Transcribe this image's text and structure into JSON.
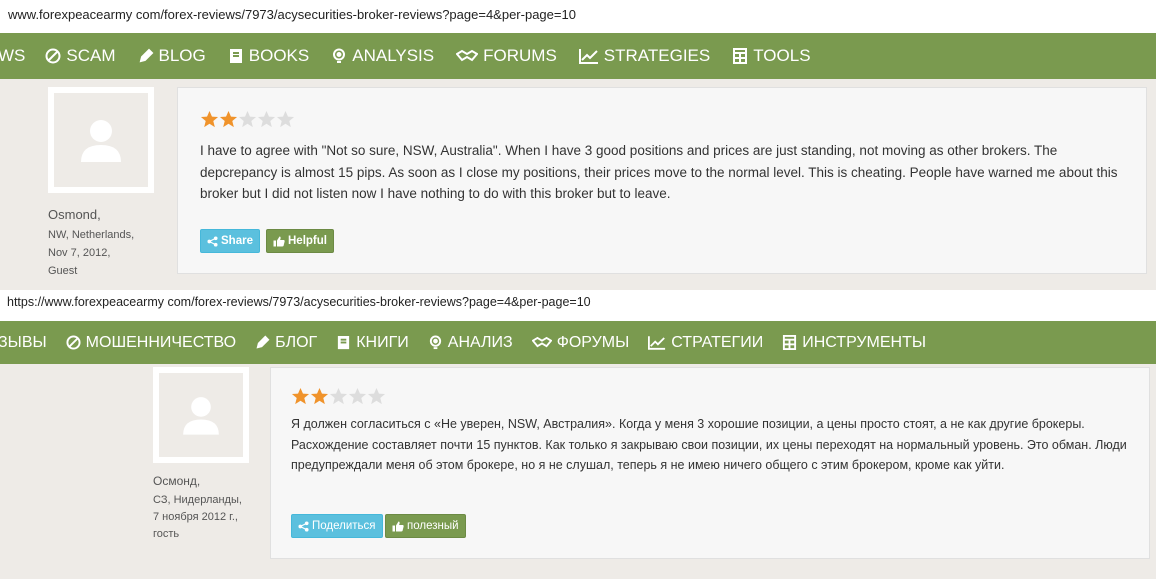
{
  "top": {
    "url": "www.forexpeacearmy com/forex-reviews/7973/acysecurities-broker-reviews?page=4&per-page=10",
    "nav": [
      {
        "label": "WS",
        "icon": "none"
      },
      {
        "label": "SCAM",
        "icon": "ban-icon"
      },
      {
        "label": "BLOG",
        "icon": "pencil-icon"
      },
      {
        "label": "BOOKS",
        "icon": "book-icon"
      },
      {
        "label": "ANALYSIS",
        "icon": "lightbulb-icon"
      },
      {
        "label": "FORUMS",
        "icon": "handshake-icon"
      },
      {
        "label": "STRATEGIES",
        "icon": "chart-icon"
      },
      {
        "label": "TOOLS",
        "icon": "calculator-icon"
      }
    ],
    "review": {
      "rating": 2,
      "max_rating": 5,
      "user_name": "Osmond,",
      "location": "NW, Netherlands,",
      "date": "Nov 7, 2012,",
      "role": "Guest",
      "text": "I have to agree with \"Not so sure, NSW, Australia\". When I have 3 good positions and prices are just standing, not moving as other brokers. The depcrepancy is almost 15 pips. As soon as I close my positions, their prices move to the normal level. This is cheating. People have warned me about this broker but I did not listen now I have nothing to do with this broker but to leave.",
      "share_label": "Share",
      "helpful_label": "Helpful"
    }
  },
  "bottom": {
    "url": "https://www.forexpeacearmy com/forex-reviews/7973/acysecurities-broker-reviews?page=4&per-page=10",
    "nav": [
      {
        "label": "ЗЫВЫ",
        "icon": "none"
      },
      {
        "label": "МОШЕННИЧЕСТВО",
        "icon": "ban-icon"
      },
      {
        "label": "БЛОГ",
        "icon": "pencil-icon"
      },
      {
        "label": "КНИГИ",
        "icon": "book-icon"
      },
      {
        "label": "АНАЛИЗ",
        "icon": "lightbulb-icon"
      },
      {
        "label": "ФОРУМЫ",
        "icon": "handshake-icon"
      },
      {
        "label": "СТРАТЕГИИ",
        "icon": "chart-icon"
      },
      {
        "label": "ИНСТРУМЕНТЫ",
        "icon": "calculator-icon"
      }
    ],
    "review": {
      "rating": 2,
      "max_rating": 5,
      "user_name": "Осмонд,",
      "location": "СЗ, Нидерланды,",
      "date": "7 ноября 2012 г.,",
      "role": "гость",
      "text": "Я должен согласиться с «Не уверен, NSW, Австралия». Когда у меня 3 хорошие позиции, а цены просто стоят, а не как другие брокеры. Расхождение составляет почти 15 пунктов. Как только я закрываю свои позиции, их цены переходят на нормальный уровень. Это обман. Люди предупреждали меня об этом брокере, но я не слушал, теперь я не имею ничего общего с этим брокером, кроме как уйти.",
      "share_label": "Поделиться",
      "helpful_label": "полезный"
    }
  },
  "colors": {
    "nav_bg": "#7a9a4f",
    "page_bg": "#eeebe7",
    "star_filled": "#f0932b",
    "star_empty": "#dddddd",
    "share_bg": "#5bc0de",
    "helpful_bg": "#7a9a4f"
  }
}
